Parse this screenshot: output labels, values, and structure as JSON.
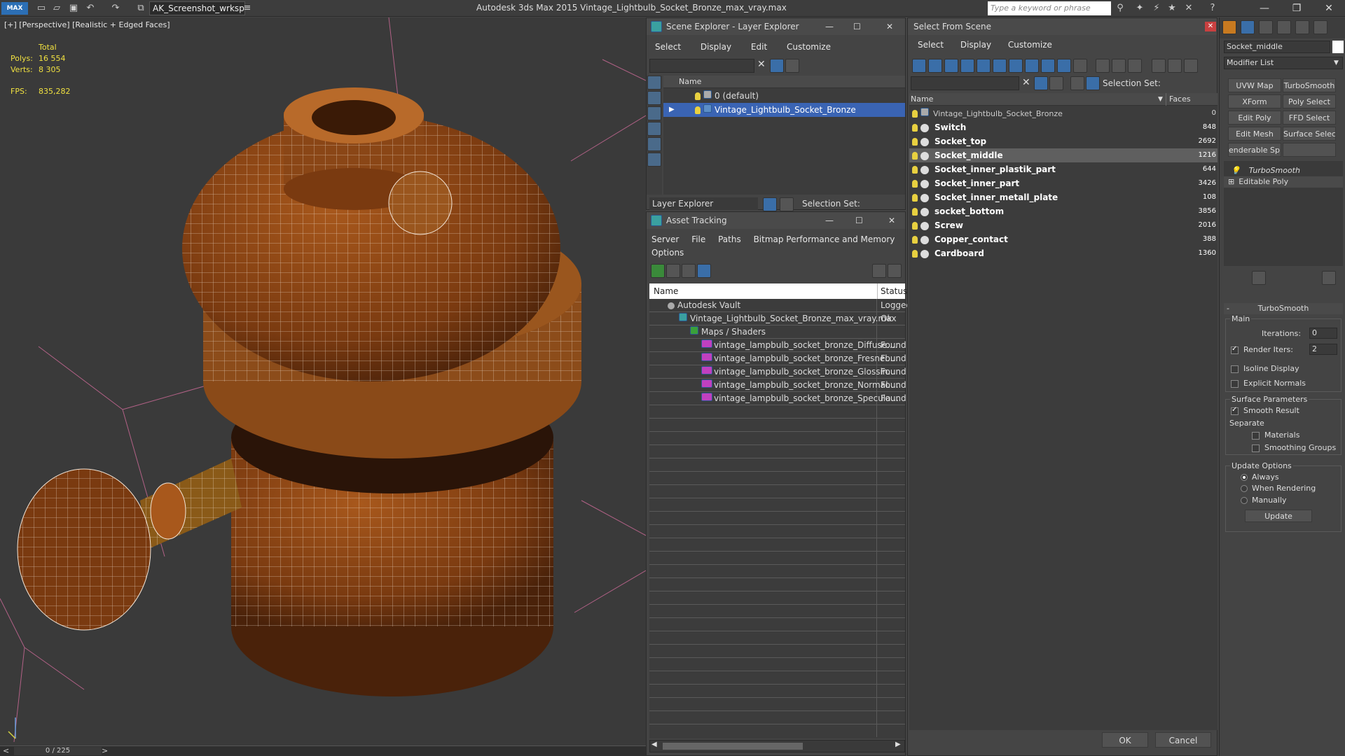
{
  "titlebar": {
    "app_icon": "MAX",
    "workspace": "AK_Screenshot_wrksp",
    "title": "Autodesk 3ds Max  2015    Vintage_Lightbulb_Socket_Bronze_max_vray.max",
    "search_placeholder": "Type a keyword or phrase"
  },
  "viewport": {
    "label": "[+] [Perspective] [Realistic + Edged Faces]",
    "stats": {
      "total_label": "Total",
      "polys_label": "Polys:",
      "polys_value": "16 554",
      "verts_label": "Verts:",
      "verts_value": "8 305",
      "fps_label": "FPS:",
      "fps_value": "835,282"
    }
  },
  "timeline": {
    "prev": "<",
    "frame": "0 / 225",
    "next": ">"
  },
  "scene_explorer": {
    "title": "Scene Explorer - Layer Explorer",
    "menu": [
      "Select",
      "Display",
      "Edit",
      "Customize"
    ],
    "column": "Name",
    "rows": [
      "0 (default)",
      "Vintage_Lightbulb_Socket_Bronze"
    ],
    "footer_dropdown": "Layer Explorer",
    "footer_selection": "Selection Set:"
  },
  "asset_tracking": {
    "title": "Asset Tracking",
    "menu": [
      "Server",
      "File",
      "Paths",
      "Bitmap Performance and Memory"
    ],
    "menu2": "Options",
    "col_name": "Name",
    "col_status": "Status",
    "rows": [
      {
        "name": "Autodesk Vault",
        "status": "Logged"
      },
      {
        "name": "Vintage_Lightbulb_Socket_Bronze_max_vray.max",
        "status": "Ok"
      },
      {
        "name": "Maps / Shaders",
        "status": ""
      },
      {
        "name": "vintage_lampbulb_socket_bronze_Diffuse....",
        "status": "Found"
      },
      {
        "name": "vintage_lampbulb_socket_bronze_Fresnel....",
        "status": "Found"
      },
      {
        "name": "vintage_lampbulb_socket_bronze_Glossin...",
        "status": "Found"
      },
      {
        "name": "vintage_lampbulb_socket_bronze_Normal....",
        "status": "Found"
      },
      {
        "name": "vintage_lampbulb_socket_bronze_Specula...",
        "status": "Found"
      }
    ]
  },
  "select_from_scene": {
    "title": "Select From Scene",
    "menu": [
      "Select",
      "Display",
      "Customize"
    ],
    "selection_set": "Selection Set:",
    "col_name": "Name",
    "col_faces": "Faces",
    "rows": [
      {
        "name": "Vintage_Lightbulb_Socket_Bronze",
        "faces": "0"
      },
      {
        "name": "Switch",
        "faces": "848"
      },
      {
        "name": "Socket_top",
        "faces": "2692"
      },
      {
        "name": "Socket_middle",
        "faces": "1216"
      },
      {
        "name": "Socket_inner_plastik_part",
        "faces": "644"
      },
      {
        "name": "Socket_inner_part",
        "faces": "3426"
      },
      {
        "name": "Socket_inner_metall_plate",
        "faces": "108"
      },
      {
        "name": "socket_bottom",
        "faces": "3856"
      },
      {
        "name": "Screw",
        "faces": "2016"
      },
      {
        "name": "Copper_contact",
        "faces": "388"
      },
      {
        "name": "Cardboard",
        "faces": "1360"
      }
    ],
    "ok": "OK",
    "cancel": "Cancel"
  },
  "command_panel": {
    "object_name": "Socket_middle",
    "modifier_list": "Modifier List",
    "buttons": [
      "UVW Map",
      "TurboSmooth",
      "XForm",
      "Poly Select",
      "Edit Poly",
      "FFD Select",
      "Edit Mesh",
      "Surface Select",
      "enderable Splir",
      ""
    ],
    "stack": [
      "TurboSmooth",
      "Editable Poly"
    ],
    "rollout_title": "TurboSmooth",
    "main_label": "Main",
    "iterations_label": "Iterations:",
    "iterations_value": "0",
    "render_iters_label": "Render Iters:",
    "render_iters_value": "2",
    "isoline": "Isoline Display",
    "explicit": "Explicit Normals",
    "surface_params": "Surface Parameters",
    "smooth_result": "Smooth Result",
    "separate": "Separate",
    "materials": "Materials",
    "smoothing_groups": "Smoothing Groups",
    "update_options": "Update Options",
    "always": "Always",
    "when_rendering": "When Rendering",
    "manually": "Manually",
    "update_btn": "Update"
  }
}
